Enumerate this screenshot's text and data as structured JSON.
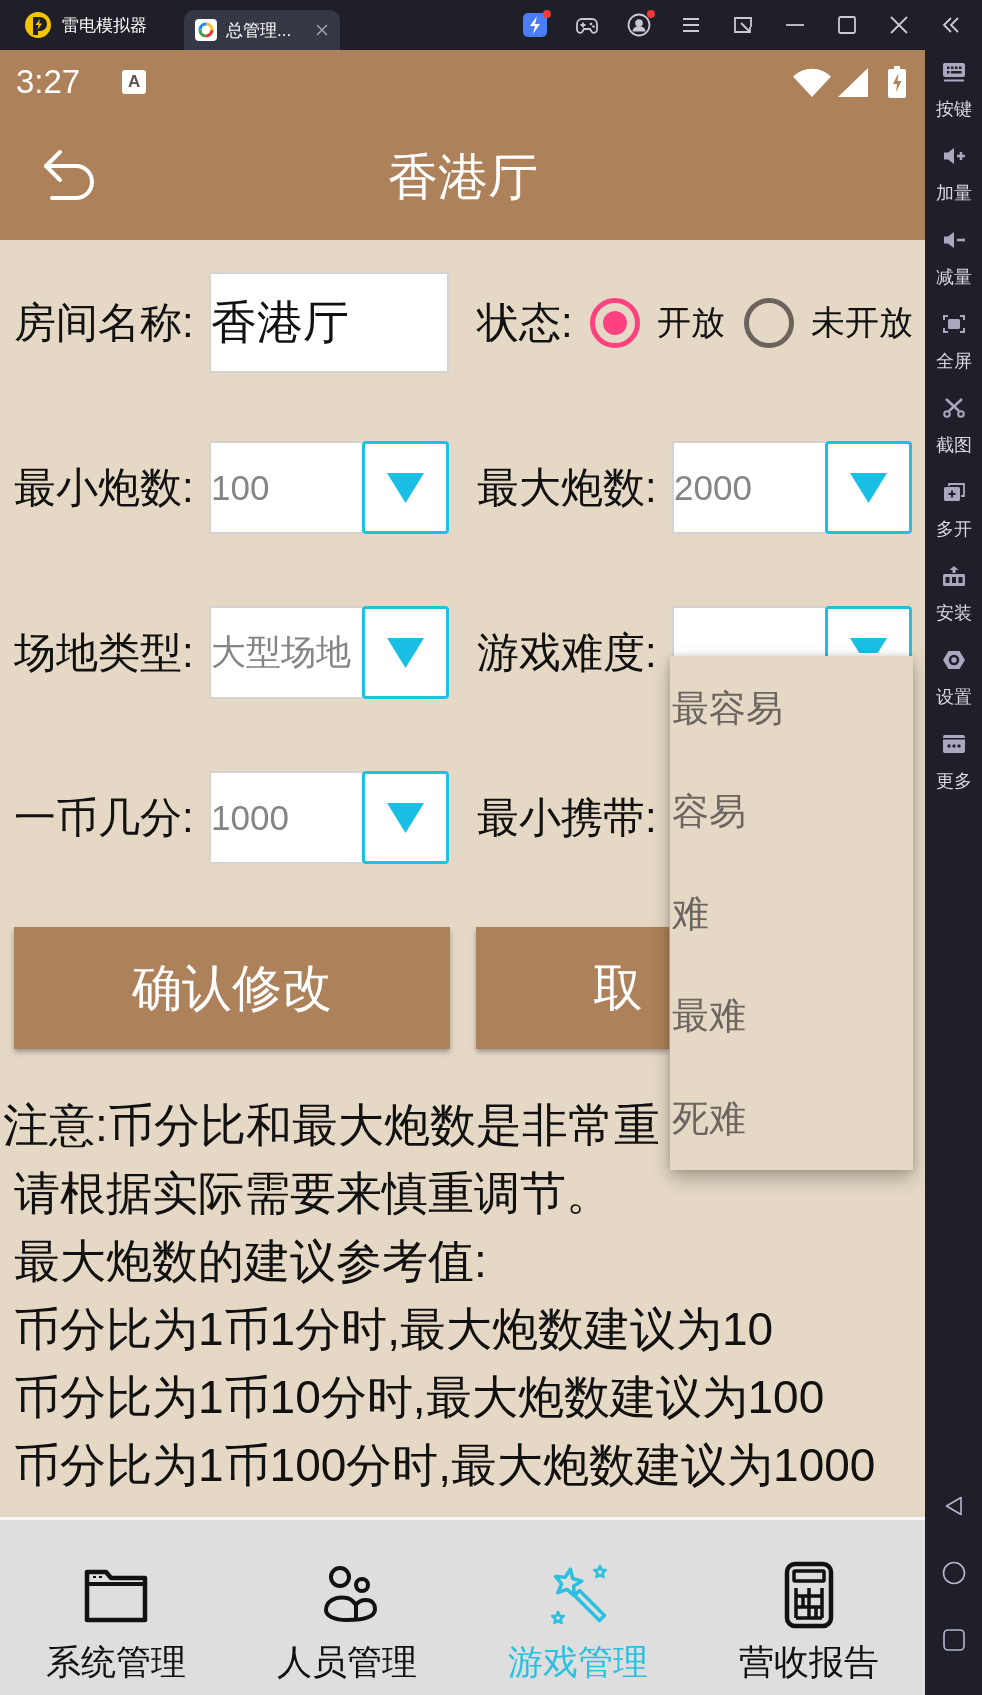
{
  "emulator": {
    "app_name": "雷电模拟器",
    "tabs": [
      {
        "label": "总管理...",
        "selected": true
      }
    ]
  },
  "sidebar": {
    "items": [
      {
        "label": "按键"
      },
      {
        "label": "加量"
      },
      {
        "label": "减量"
      },
      {
        "label": "全屏"
      },
      {
        "label": "截图"
      },
      {
        "label": "多开"
      },
      {
        "label": "安装"
      },
      {
        "label": "设置"
      },
      {
        "label": "更多"
      }
    ]
  },
  "status_bar": {
    "time": "3:27",
    "notification": "A"
  },
  "app_bar": {
    "title": "香港厅"
  },
  "form": {
    "room_name": {
      "label": "房间名称:",
      "value": "香港厅"
    },
    "status": {
      "label": "状态:",
      "options": [
        {
          "label": "开放",
          "selected": true
        },
        {
          "label": "未开放",
          "selected": false
        }
      ]
    },
    "fields": [
      {
        "kind": "spinner",
        "label": "最小炮数:",
        "value": "100",
        "expanded": false
      },
      {
        "kind": "spinner",
        "label": "最大炮数:",
        "value": "2000",
        "expanded": false
      },
      {
        "kind": "spinner",
        "label": "场地类型:",
        "value": "大型场地",
        "expanded": false
      },
      {
        "kind": "spinner",
        "label": "游戏难度:",
        "expanded": true,
        "options": [
          "最容易",
          "容易",
          "难",
          "最难",
          "死难"
        ]
      },
      {
        "kind": "spinner",
        "label": "一币几分:",
        "value": "1000",
        "expanded": false
      },
      {
        "kind": "label",
        "label": "最小携带:"
      }
    ]
  },
  "buttons": [
    {
      "label": "确认修改"
    },
    {
      "label": "取"
    }
  ],
  "notes": [
    "注意:币分比和最大炮数是非常重",
    "请根据实际需要来慎重调节。",
    "最大炮数的建议参考值:",
    "币分比为1币1分时,最大炮数建议为10",
    "币分比为1币10分时,最大炮数建议为100",
    "币分比为1币100分时,最大炮数建议为1000"
  ],
  "bottom_nav": {
    "items": [
      {
        "label": "系统管理",
        "selected": false
      },
      {
        "label": "人员管理",
        "selected": false
      },
      {
        "label": "游戏管理",
        "selected": true
      },
      {
        "label": "营收报告",
        "selected": false
      }
    ]
  }
}
